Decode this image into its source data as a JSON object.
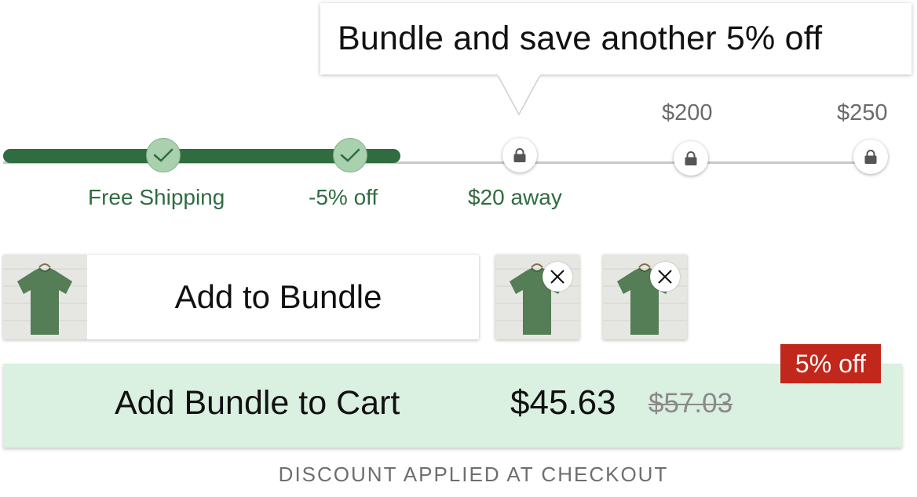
{
  "tooltip": {
    "text": "Bundle and save another 5% off"
  },
  "progress": {
    "fill_fraction": 0.45,
    "tiers": [
      {
        "label": "Free Shipping",
        "state": "completed",
        "icon": "check-icon"
      },
      {
        "label": "-5% off",
        "state": "completed",
        "icon": "check-icon"
      },
      {
        "label": "$20 away",
        "state": "locked",
        "icon": "lock-icon"
      },
      {
        "price": "$200",
        "state": "locked",
        "icon": "lock-icon"
      },
      {
        "price": "$250",
        "state": "locked",
        "icon": "lock-icon"
      }
    ]
  },
  "bundle": {
    "add_label": "Add to Bundle",
    "items": [
      {
        "icon": "tshirt-image",
        "remove_icon": "close-icon"
      },
      {
        "icon": "tshirt-image",
        "remove_icon": "close-icon"
      }
    ]
  },
  "cart": {
    "label": "Add Bundle to Cart",
    "price": "$45.63",
    "original_price": "$57.03",
    "badge": "5% off"
  },
  "note": "DISCOUNT APPLIED AT CHECKOUT",
  "colors": {
    "accent_green": "#2f6c40",
    "milestone_done": "#a9d1ae",
    "cart_background": "#daf0e1",
    "badge_red": "#c1271b"
  }
}
